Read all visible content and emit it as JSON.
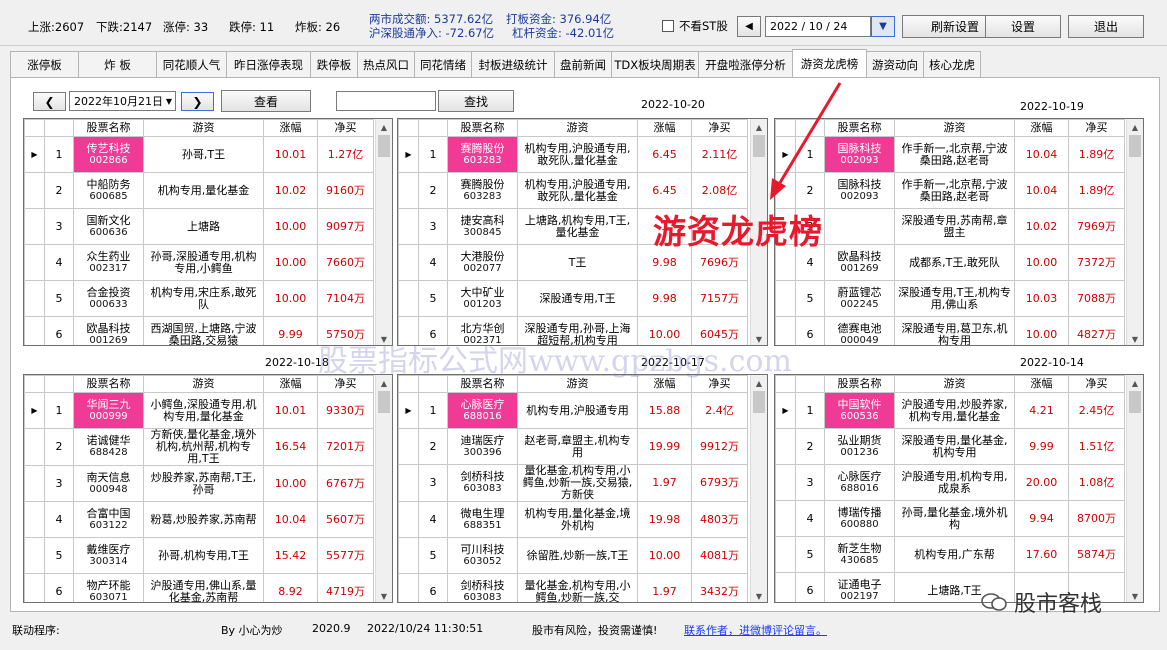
{
  "topbar": {
    "up_label": "上涨:2607",
    "down_label": "下跌:2147",
    "limitup_label": "涨停: 33",
    "limitdown_label": "跌停: 11",
    "broken_label": "炸板: 26",
    "turnover_label": "两市成交额: 5377.62亿",
    "hit_board_label": "打板资金: 376.94亿",
    "hk_label": "沪深股通净入: -72.67亿",
    "leverage_label": "杠杆资金: -42.01亿",
    "no_st_label": "不看ST股",
    "date_value": "2022 / 10 / 24",
    "refresh_label": "刷新设置",
    "settings_label": "设置",
    "exit_label": "退出"
  },
  "tabs": [
    "涨停板",
    "炸 板",
    "同花顺人气",
    "昨日涨停表现",
    "跌停板",
    "热点风口",
    "同花情绪",
    "封板进级统计",
    "盘前新闻",
    "TDX板块周期表",
    "开盘啦涨停分析",
    "游资龙虎榜",
    "游资动向",
    "核心龙虎"
  ],
  "controls": {
    "date_select": "2022年10月21日",
    "view_label": "查看",
    "search_value": "",
    "search_label": "查找"
  },
  "columns": {
    "stock": "股票名称",
    "trader": "游资",
    "change": "涨幅",
    "net": "净买"
  },
  "panels": [
    {
      "date": "",
      "rows": [
        {
          "n": "1",
          "name": "传艺科技",
          "code": "002866",
          "trader": "孙哥,T王",
          "chg": "10.01",
          "net": "1.27亿",
          "hl": true
        },
        {
          "n": "2",
          "name": "中船防务",
          "code": "600685",
          "trader": "机构专用,量化基金",
          "chg": "10.02",
          "net": "9160万",
          "hl": false
        },
        {
          "n": "3",
          "name": "国新文化",
          "code": "600636",
          "trader": "上塘路",
          "chg": "10.00",
          "net": "9097万",
          "hl": false
        },
        {
          "n": "4",
          "name": "众生药业",
          "code": "002317",
          "trader": "孙哥,深股通专用,机构专用,小鳄鱼",
          "chg": "10.00",
          "net": "7660万",
          "hl": false
        },
        {
          "n": "5",
          "name": "合金投资",
          "code": "000633",
          "trader": "机构专用,宋庄系,敢死队",
          "chg": "10.00",
          "net": "7104万",
          "hl": false
        },
        {
          "n": "6",
          "name": "欧晶科技",
          "code": "001269",
          "trader": "西湖国贸,上塘路,宁波桑田路,交易猿",
          "chg": "9.99",
          "net": "5750万",
          "hl": false
        }
      ]
    },
    {
      "date": "2022-10-20",
      "rows": [
        {
          "n": "1",
          "name": "赛腾股份",
          "code": "603283",
          "trader": "机构专用,沪股通专用,敢死队,量化基金",
          "chg": "6.45",
          "net": "2.11亿",
          "hl": true
        },
        {
          "n": "2",
          "name": "赛腾股份",
          "code": "603283",
          "trader": "机构专用,沪股通专用,敢死队,量化基金",
          "chg": "6.45",
          "net": "2.08亿",
          "hl": false
        },
        {
          "n": "3",
          "name": "捷安高科",
          "code": "300845",
          "trader": "上塘路,机构专用,T王,量化基金",
          "chg": "1",
          "net": "",
          "hl": false
        },
        {
          "n": "4",
          "name": "大港股份",
          "code": "002077",
          "trader": "T王",
          "chg": "9.98",
          "net": "7696万",
          "hl": false
        },
        {
          "n": "5",
          "name": "大中矿业",
          "code": "001203",
          "trader": "深股通专用,T王",
          "chg": "9.98",
          "net": "7157万",
          "hl": false
        },
        {
          "n": "6",
          "name": "北方华创",
          "code": "002371",
          "trader": "深股通专用,孙哥,上海超短帮,机构专用",
          "chg": "10.00",
          "net": "6045万",
          "hl": false
        }
      ]
    },
    {
      "date": "2022-10-19",
      "rows": [
        {
          "n": "1",
          "name": "国脉科技",
          "code": "002093",
          "trader": "作手新一,北京帮,宁波桑田路,赵老哥",
          "chg": "10.04",
          "net": "1.89亿",
          "hl": true
        },
        {
          "n": "2",
          "name": "国脉科技",
          "code": "002093",
          "trader": "作手新一,北京帮,宁波桑田路,赵老哥",
          "chg": "10.04",
          "net": "1.89亿",
          "hl": false
        },
        {
          "n": "3",
          "name": "",
          "code": "",
          "trader": "深股通专用,苏南帮,章盟主",
          "chg": "10.02",
          "net": "7969万",
          "hl": false
        },
        {
          "n": "4",
          "name": "欧晶科技",
          "code": "001269",
          "trader": "成都系,T王,敢死队",
          "chg": "10.00",
          "net": "7372万",
          "hl": false
        },
        {
          "n": "5",
          "name": "蔚蓝锂芯",
          "code": "002245",
          "trader": "深股通专用,T王,机构专用,佛山系",
          "chg": "10.03",
          "net": "7088万",
          "hl": false
        },
        {
          "n": "6",
          "name": "德赛电池",
          "code": "000049",
          "trader": "深股通专用,葛卫东,机构专用",
          "chg": "10.00",
          "net": "4827万",
          "hl": false
        }
      ]
    },
    {
      "date": "2022-10-18",
      "rows": [
        {
          "n": "1",
          "name": "华闻三九",
          "code": "000999",
          "trader": "小鳄鱼,深股通专用,机构专用,量化基金",
          "chg": "10.01",
          "net": "9330万",
          "hl": true
        },
        {
          "n": "2",
          "name": "诺诚健华",
          "code": "688428",
          "trader": "方新侠,量化基金,境外机构,杭州帮,机构专用,T王",
          "chg": "16.54",
          "net": "7201万",
          "hl": false
        },
        {
          "n": "3",
          "name": "南天信息",
          "code": "000948",
          "trader": "炒股养家,苏南帮,T王,孙哥",
          "chg": "10.00",
          "net": "6767万",
          "hl": false
        },
        {
          "n": "4",
          "name": "合富中国",
          "code": "603122",
          "trader": "粉葛,炒股养家,苏南帮",
          "chg": "10.04",
          "net": "5607万",
          "hl": false
        },
        {
          "n": "5",
          "name": "戴维医疗",
          "code": "300314",
          "trader": "孙哥,机构专用,T王",
          "chg": "15.42",
          "net": "5577万",
          "hl": false
        },
        {
          "n": "6",
          "name": "物产环能",
          "code": "603071",
          "trader": "沪股通专用,佛山系,量化基金,苏南帮",
          "chg": "8.92",
          "net": "4719万",
          "hl": false
        }
      ]
    },
    {
      "date": "2022-10-17",
      "rows": [
        {
          "n": "1",
          "name": "心脉医疗",
          "code": "688016",
          "trader": "机构专用,沪股通专用",
          "chg": "15.88",
          "net": "2.4亿",
          "hl": true
        },
        {
          "n": "2",
          "name": "迪瑞医疗",
          "code": "300396",
          "trader": "赵老哥,章盟主,机构专用",
          "chg": "19.99",
          "net": "9912万",
          "hl": false
        },
        {
          "n": "3",
          "name": "剑桥科技",
          "code": "603083",
          "trader": "量化基金,机构专用,小鳄鱼,炒新一族,交易猿,方新侠",
          "chg": "1.97",
          "net": "6793万",
          "hl": false
        },
        {
          "n": "4",
          "name": "微电生理",
          "code": "688351",
          "trader": "机构专用,量化基金,境外机构",
          "chg": "19.98",
          "net": "4803万",
          "hl": false
        },
        {
          "n": "5",
          "name": "可川科技",
          "code": "603052",
          "trader": "徐留胜,炒新一族,T王",
          "chg": "10.00",
          "net": "4081万",
          "hl": false
        },
        {
          "n": "6",
          "name": "剑桥科技",
          "code": "603083",
          "trader": "量化基金,机构专用,小鳄鱼,炒新一族,交",
          "chg": "1.97",
          "net": "3432万",
          "hl": false
        }
      ]
    },
    {
      "date": "2022-10-14",
      "rows": [
        {
          "n": "1",
          "name": "中国软件",
          "code": "600536",
          "trader": "沪股通专用,炒股养家,机构专用,量化基金",
          "chg": "4.21",
          "net": "2.45亿",
          "hl": true
        },
        {
          "n": "2",
          "name": "弘业期货",
          "code": "001236",
          "trader": "深股通专用,量化基金,机构专用",
          "chg": "9.99",
          "net": "1.51亿",
          "hl": false
        },
        {
          "n": "3",
          "name": "心脉医疗",
          "code": "688016",
          "trader": "沪股通专用,机构专用,成泉系",
          "chg": "20.00",
          "net": "1.08亿",
          "hl": false
        },
        {
          "n": "4",
          "name": "博瑞传播",
          "code": "600880",
          "trader": "孙哥,量化基金,境外机构",
          "chg": "9.94",
          "net": "8700万",
          "hl": false
        },
        {
          "n": "5",
          "name": "新芝生物",
          "code": "430685",
          "trader": "机构专用,广东帮",
          "chg": "17.60",
          "net": "5874万",
          "hl": false
        },
        {
          "n": "6",
          "name": "证通电子",
          "code": "002197",
          "trader": "上塘路,T王",
          "chg": "",
          "net": "",
          "hl": false
        }
      ]
    }
  ],
  "overlay": {
    "red_title": "游资龙虎榜",
    "watermark": "股票指标公式网www.gpzbgs.com",
    "brand": "股市客栈"
  },
  "status": {
    "program": "联动程序:",
    "author": "By 小心为炒",
    "version": "2020.9",
    "datetime": "2022/10/24 11:30:51",
    "risk": "股市有风险，投资需谨慎!",
    "contact": "联系作者，进微博评论留言。"
  }
}
